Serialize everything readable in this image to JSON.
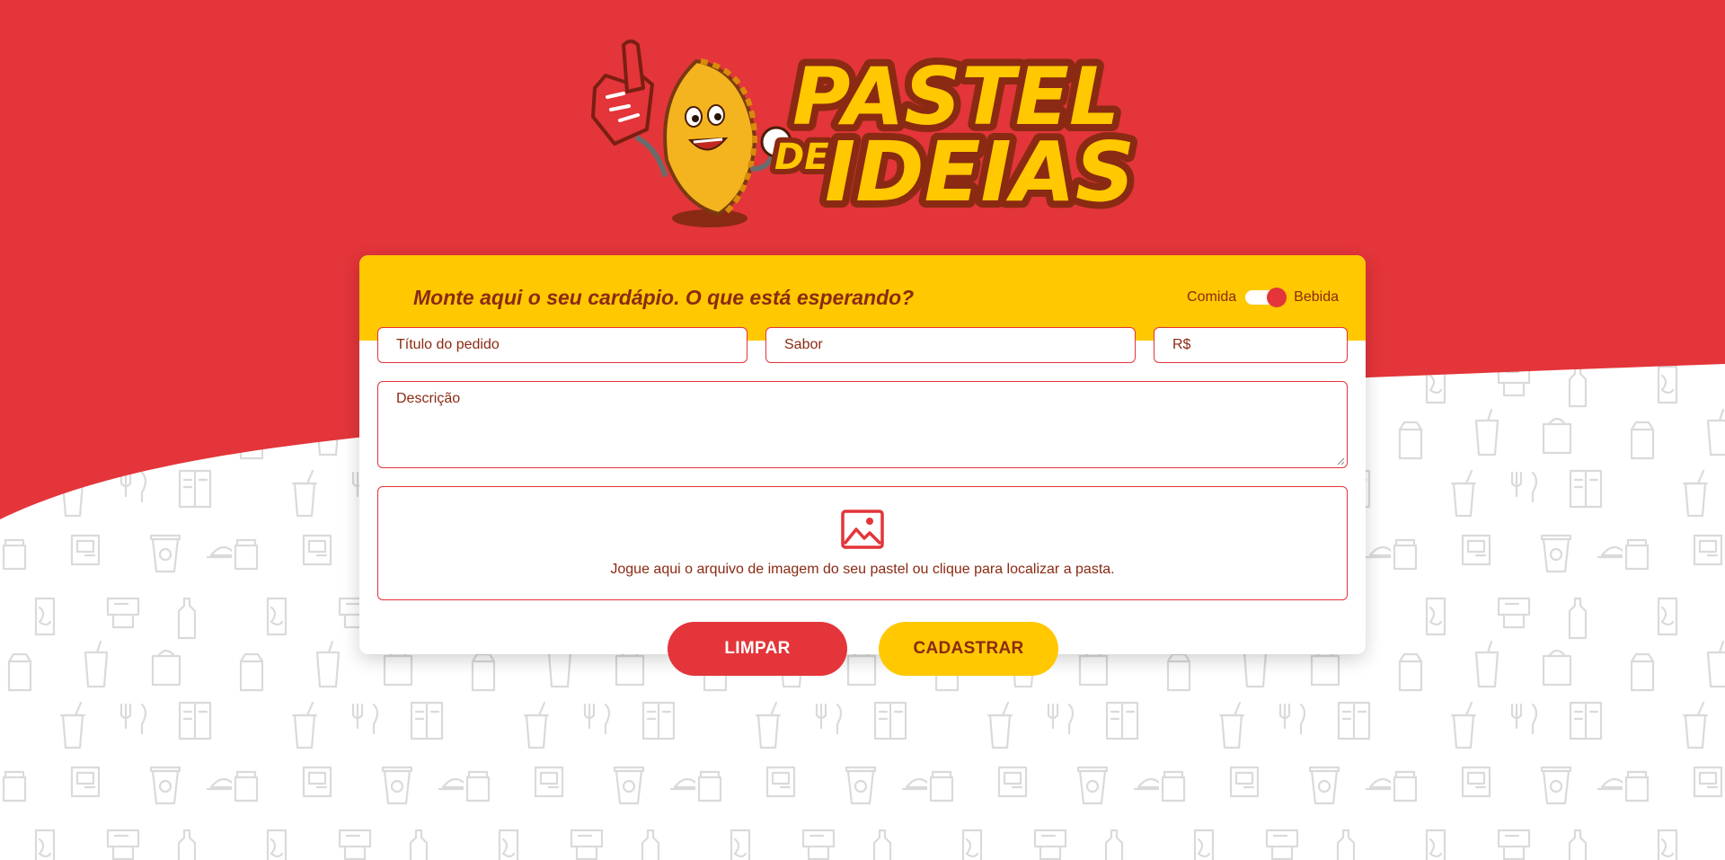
{
  "colors": {
    "brand_red": "#e3353a",
    "brand_yellow": "#ffc800",
    "brand_brown": "#8a2a12",
    "pattern_gray": "#d9d9d9"
  },
  "logo": {
    "line1": "PASTEL",
    "line2_small": "DE",
    "line2": "IDEIAS",
    "mascot_icon": "pastel-mascot-icon"
  },
  "form": {
    "title": "Monte aqui o seu cardápio. O que está esperando?",
    "toggle": {
      "left_label": "Comida",
      "right_label": "Bebida",
      "selected": "Bebida"
    },
    "fields": {
      "title_placeholder": "Título do pedido",
      "flavor_placeholder": "Sabor",
      "price_placeholder": "R$",
      "description_placeholder": "Descrição"
    },
    "dropzone": {
      "icon": "image-icon",
      "text": "Jogue aqui o arquivo de imagem do seu pastel ou clique para localizar a pasta."
    },
    "buttons": {
      "clear": "LIMPAR",
      "submit": "CADASTRAR"
    }
  }
}
